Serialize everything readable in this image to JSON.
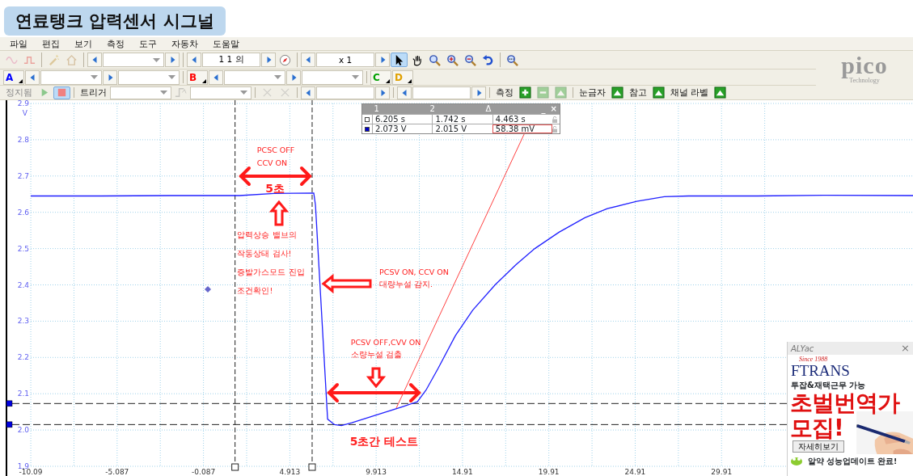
{
  "title": "연료탱크 압력센서 시그널",
  "menu": [
    "파일",
    "편집",
    "보기",
    "측정",
    "도구",
    "자동차",
    "도움말"
  ],
  "toolbar_1": [
    {
      "kind": "tool",
      "selected": false,
      "disabled": true
    },
    {
      "kind": "tool",
      "selected": false,
      "disabled": true
    },
    {
      "kind": "sep"
    },
    {
      "kind": "tool",
      "selected": false,
      "disabled": true
    },
    {
      "kind": "tool",
      "selected": false,
      "disabled": true
    },
    {
      "kind": "sep"
    },
    {
      "kind": "prev"
    },
    {
      "kind": "dropdown"
    },
    {
      "kind": "next"
    },
    {
      "kind": "sep"
    },
    {
      "kind": "prev"
    },
    {
      "kind": "field",
      "value": "1 1 의"
    },
    {
      "kind": "next"
    },
    {
      "kind": "tool",
      "selected": false,
      "disabled": false
    },
    {
      "kind": "sep"
    },
    {
      "kind": "prev"
    },
    {
      "kind": "field",
      "value": "x 1"
    },
    {
      "kind": "next"
    },
    {
      "kind": "tool",
      "selected": true,
      "disabled": false
    },
    {
      "kind": "tool",
      "selected": false,
      "disabled": false
    },
    {
      "kind": "tool",
      "selected": false,
      "disabled": false
    },
    {
      "kind": "tool",
      "selected": false,
      "disabled": false
    },
    {
      "kind": "tool",
      "selected": false,
      "disabled": false
    },
    {
      "kind": "tool",
      "selected": false,
      "disabled": false
    },
    {
      "kind": "sep"
    },
    {
      "kind": "tool",
      "selected": false,
      "disabled": false
    }
  ],
  "toolbar_2": [
    {
      "kind": "channel",
      "label": "A",
      "color": "#0000ff"
    },
    {
      "kind": "prev"
    },
    {
      "kind": "dropdown"
    },
    {
      "kind": "next"
    },
    {
      "kind": "dropdown"
    },
    {
      "kind": "sep"
    },
    {
      "kind": "channel",
      "label": "B",
      "color": "#ff0000"
    },
    {
      "kind": "prev"
    },
    {
      "kind": "dropdown"
    },
    {
      "kind": "next"
    },
    {
      "kind": "dropdown"
    },
    {
      "kind": "sep"
    },
    {
      "kind": "channel",
      "label": "C",
      "color": "#00a000"
    },
    {
      "kind": "channel",
      "label": "D",
      "color": "#e0a000"
    }
  ],
  "logo": {
    "name": "pico",
    "tagline": "Technology"
  },
  "toolbar_3": [
    {
      "kind": "label",
      "text": "정지됨",
      "disabled": true
    },
    {
      "kind": "tool",
      "selected": false,
      "disabled": false
    },
    {
      "kind": "tool",
      "selected": true,
      "disabled": false
    },
    {
      "kind": "sep"
    },
    {
      "kind": "label",
      "text": "트리거",
      "disabled": false
    },
    {
      "kind": "dropdown"
    },
    {
      "kind": "tool",
      "selected": false,
      "disabled": true
    },
    {
      "kind": "dropdown"
    },
    {
      "kind": "sep"
    },
    {
      "kind": "tool",
      "selected": false,
      "disabled": true
    },
    {
      "kind": "tool",
      "selected": false,
      "disabled": true
    },
    {
      "kind": "sep"
    },
    {
      "kind": "prev"
    },
    {
      "kind": "field"
    },
    {
      "kind": "next"
    },
    {
      "kind": "sep"
    },
    {
      "kind": "prev"
    },
    {
      "kind": "field"
    },
    {
      "kind": "next"
    },
    {
      "kind": "sep"
    },
    {
      "kind": "label",
      "text": "측정",
      "disabled": false
    },
    {
      "kind": "tool",
      "selected": false,
      "disabled": false
    },
    {
      "kind": "tool",
      "selected": false,
      "disabled": true
    },
    {
      "kind": "tool",
      "selected": false,
      "disabled": true
    },
    {
      "kind": "sep"
    },
    {
      "kind": "label",
      "text": "눈금자",
      "disabled": false
    },
    {
      "kind": "tool",
      "selected": false,
      "disabled": false
    },
    {
      "kind": "label",
      "text": "참고",
      "disabled": false
    },
    {
      "kind": "tool",
      "selected": false,
      "disabled": false
    },
    {
      "kind": "label",
      "text": "채널 라벨",
      "disabled": false
    },
    {
      "kind": "tool",
      "selected": false,
      "disabled": false
    }
  ],
  "scope": {
    "chart_data": {
      "type": "line",
      "ylabel": "V",
      "xlim": [
        -10.09,
        41
      ],
      "ylim": [
        1.9,
        2.9
      ],
      "grid": true,
      "xticks": [
        {
          "value": -10.087,
          "label": "-10.09"
        },
        {
          "value": -5.087,
          "label": "-5.087"
        },
        {
          "value": -0.087,
          "label": "-0.087"
        },
        {
          "value": 4.913,
          "label": "4.913"
        },
        {
          "value": 9.913,
          "label": "9.913"
        },
        {
          "value": 14.913,
          "label": "14.91"
        },
        {
          "value": 19.913,
          "label": "19.91"
        },
        {
          "value": 24.913,
          "label": "24.91"
        },
        {
          "value": 29.913,
          "label": "29.91"
        }
      ],
      "yticks": [
        {
          "value": 2.9,
          "label": "2.9"
        },
        {
          "value": 2.8,
          "label": "2.8"
        },
        {
          "value": 2.7,
          "label": "2.7"
        },
        {
          "value": 2.6,
          "label": "2.6"
        },
        {
          "value": 2.5,
          "label": "2.5"
        },
        {
          "value": 2.4,
          "label": "2.4"
        },
        {
          "value": 2.3,
          "label": "2.3"
        },
        {
          "value": 2.2,
          "label": "2.2"
        },
        {
          "value": 2.1,
          "label": "2.1"
        },
        {
          "value": 2.0,
          "label": "2.0"
        },
        {
          "value": 1.9,
          "label": "1.9"
        }
      ],
      "x": [
        -10.09,
        -6,
        -2,
        2,
        4,
        6.3,
        6.4,
        7.1,
        7.5,
        7.9,
        8.5,
        9.5,
        10.5,
        11.5,
        12.3,
        12.8,
        13.5,
        14.5,
        15.5,
        16.8,
        18,
        19.1,
        20.5,
        22,
        23.3,
        25,
        26.6,
        28,
        32,
        36,
        41
      ],
      "series": [
        {
          "color": "#2020ff",
          "values": [
            2.645,
            2.645,
            2.646,
            2.646,
            2.652,
            2.653,
            2.62,
            2.03,
            2.015,
            2.012,
            2.02,
            2.035,
            2.05,
            2.065,
            2.078,
            2.11,
            2.17,
            2.26,
            2.33,
            2.4,
            2.455,
            2.5,
            2.545,
            2.585,
            2.61,
            2.63,
            2.643,
            2.645,
            2.645,
            2.647,
            2.646
          ]
        }
      ],
      "ref_lines": [
        {
          "axis": "x",
          "value": 1.742
        },
        {
          "axis": "x",
          "value": 6.205
        },
        {
          "axis": "y",
          "value": 2.073
        },
        {
          "axis": "y",
          "value": 2.015
        }
      ]
    }
  },
  "notes": [
    {
      "kind": "small",
      "lines": [
        "PCSC OFF",
        "CCV ON"
      ]
    },
    {
      "kind": "big",
      "lines": [
        "5초"
      ]
    },
    {
      "kind": "small",
      "lines": [
        "압력상승 밸브의",
        "작동상태 검사!",
        "증발가스모드 진입",
        "조건확인!"
      ]
    },
    {
      "kind": "small",
      "lines": [
        "PCSV ON, CCV ON",
        "대량누설 감지."
      ]
    },
    {
      "kind": "small",
      "lines": [
        "PCSV OFF,CVV ON",
        "소량누설 검출"
      ]
    },
    {
      "kind": "big",
      "lines": [
        "5초간 테스트"
      ]
    }
  ],
  "measurements": {
    "columns": [
      "1",
      "2",
      "Δ"
    ],
    "controls": [
      "_",
      "×"
    ],
    "rows": [
      {
        "color": "#ffffff",
        "cells": [
          {
            "text": "6.205 s",
            "boxed": false
          },
          {
            "text": "1.742 s",
            "boxed": false
          },
          {
            "text": "4.463 s",
            "boxed": false
          }
        ]
      },
      {
        "color": "#0000cc",
        "cells": [
          {
            "text": "2.073 V",
            "boxed": false
          },
          {
            "text": "2.015 V",
            "boxed": false
          },
          {
            "text": "58.38 mV",
            "boxed": true
          }
        ]
      }
    ]
  },
  "ad": {
    "brand": "ALYac",
    "close": "×",
    "since": "Since 1988",
    "logo": "FTRANS",
    "subtitle": "투잡&재택근무 가능",
    "headline": [
      "초벌번역가",
      "모집!"
    ],
    "button": "자세히보기",
    "footer": "알약 성능업데이트 완료!"
  }
}
